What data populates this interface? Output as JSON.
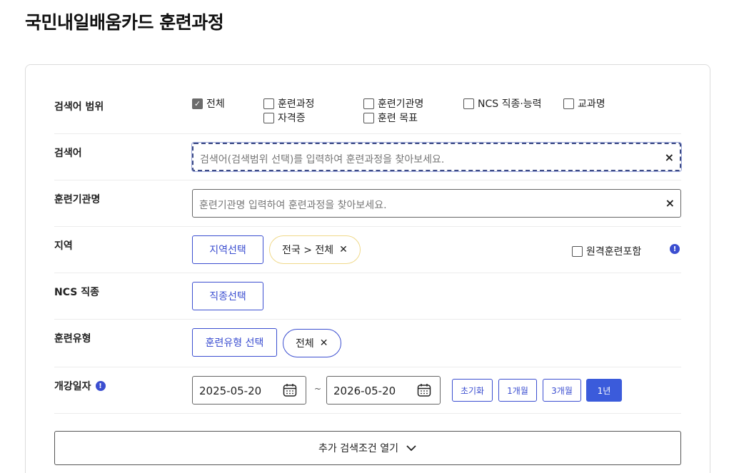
{
  "page": {
    "title": "국민내일배움카드 훈련과정"
  },
  "search_scope": {
    "label": "검색어 범위",
    "options": [
      {
        "label": "전체",
        "checked": true
      },
      {
        "label": "훈련과정",
        "checked": false
      },
      {
        "label": "훈련기관명",
        "checked": false
      },
      {
        "label": "NCS 직종·능력",
        "checked": false
      },
      {
        "label": "교과명",
        "checked": false
      },
      {
        "label": "자격증",
        "checked": false
      },
      {
        "label": "훈련 목표",
        "checked": false
      }
    ]
  },
  "keyword": {
    "label": "검색어",
    "placeholder": "검색어(검색범위 선택)를 입력하여 훈련과정을 찾아보세요.",
    "clear": "×"
  },
  "institution": {
    "label": "훈련기관명",
    "placeholder": "훈련기관명 입력하여 훈련과정을 찾아보세요.",
    "clear": "×"
  },
  "region": {
    "label": "지역",
    "select_button": "지역선택",
    "chip": "전국 > 전체",
    "remote_label": "원격훈련포함",
    "remote_checked": false
  },
  "ncs": {
    "label": "NCS 직종",
    "select_button": "직종선택"
  },
  "training_type": {
    "label": "훈련유형",
    "select_button": "훈련유형 선택",
    "chip": "전체"
  },
  "open_date": {
    "label": "개강일자",
    "start": "2025-05-20",
    "separator": "~",
    "end": "2026-05-20",
    "buttons": [
      "초기화",
      "1개월",
      "3개월",
      "1년"
    ],
    "active": "1년"
  },
  "more_conditions": {
    "label": "추가 검색조건 열기"
  },
  "icons": {
    "info": "info-icon",
    "calendar": "calendar-icon",
    "close": "close-icon",
    "chevron": "chevron-down-icon"
  },
  "colors": {
    "accent": "#3b4ed0",
    "active_button": "#3b5bdb",
    "region_chip_border": "#f0d98a"
  }
}
